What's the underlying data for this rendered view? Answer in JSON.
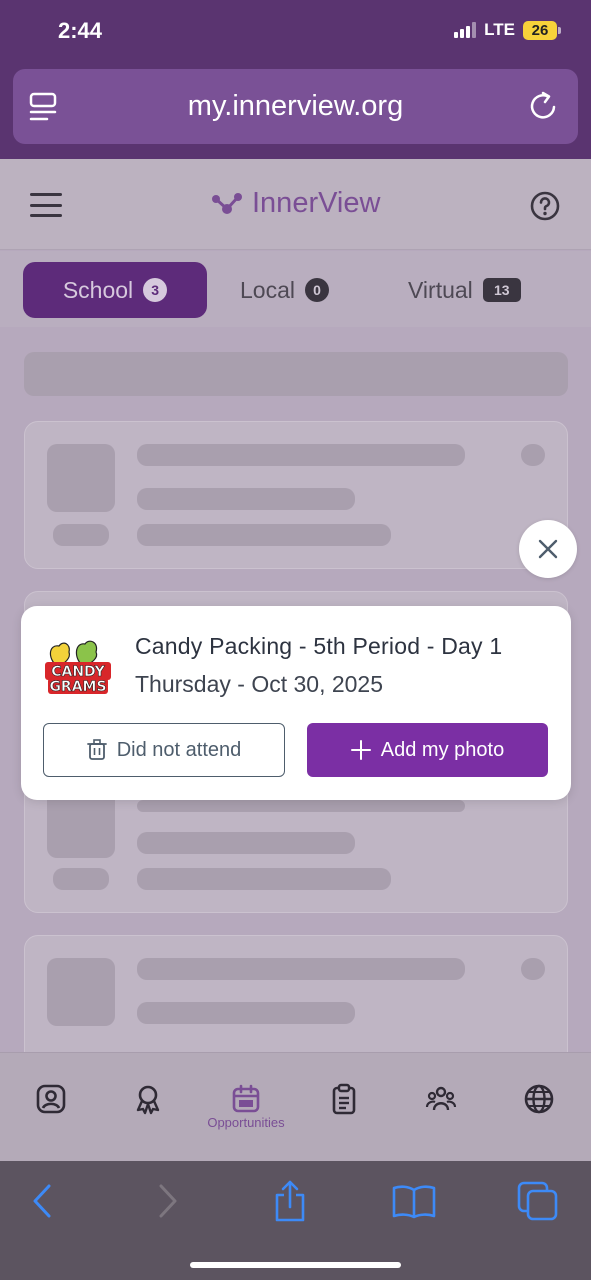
{
  "status_bar": {
    "time": "2:44",
    "network": "LTE",
    "battery": "26"
  },
  "browser": {
    "url": "my.innerview.org"
  },
  "app": {
    "logo_text": "InnerView",
    "tabs": [
      {
        "label": "School",
        "count": "3",
        "active": true
      },
      {
        "label": "Local",
        "count": "0",
        "active": false
      },
      {
        "label": "Virtual",
        "count": "13",
        "active": false
      }
    ]
  },
  "modal": {
    "title": "Candy Packing - 5th Period - Day 1",
    "date": "Thursday - Oct 30, 2025",
    "logo_text_line1": "CANDY",
    "logo_text_line2": "GRAMS",
    "did_not_attend_label": "Did not attend",
    "add_photo_label": "Add my photo"
  },
  "bottom_nav": {
    "items": [
      {
        "icon": "profile-icon"
      },
      {
        "icon": "award-icon"
      },
      {
        "icon": "calendar-icon",
        "label": "Opportunities",
        "active": true
      },
      {
        "icon": "clipboard-icon"
      },
      {
        "icon": "people-icon"
      },
      {
        "icon": "globe-icon"
      }
    ]
  },
  "colors": {
    "brand_purple": "#7b2fa4",
    "browser_purple": "#5a3470",
    "overlay_tint": "#b6a9bd"
  }
}
